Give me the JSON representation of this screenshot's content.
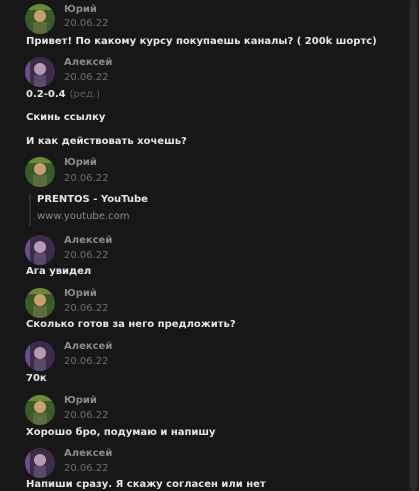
{
  "messages": [
    {
      "author": "Юрий",
      "date": "20.06.22",
      "text": "Привет! По какому курсу покупаешь каналы? ( 200k шортс)"
    },
    {
      "author": "Алексей",
      "date": "20.06.22",
      "text": "0.2-0.4",
      "edited": "(ред.)"
    },
    {
      "text": "Скинь ссылку"
    },
    {
      "text": "И как действовать хочешь?"
    },
    {
      "author": "Юрий",
      "date": "20.06.22"
    },
    {
      "author": "Алексей",
      "date": "20.06.22",
      "text": "Ага увидел"
    },
    {
      "author": "Юрий",
      "date": "20.06.22",
      "text": "Сколько готов за него предложить?"
    },
    {
      "author": "Алексей",
      "date": "20.06.22",
      "text": "70к"
    },
    {
      "author": "Юрий",
      "date": "20.06.22",
      "text": "Хорошо бро, подумаю и напишу"
    },
    {
      "author": "Алексей",
      "date": "20.06.22",
      "text": "Напиши сразу. Я скажу согласен или нет"
    }
  ],
  "link_preview": {
    "title": "PRENTOS - YouTube",
    "host": "www.youtube.com"
  },
  "colors": {
    "background": "#171717",
    "text": "#e6e6e6",
    "author": "#8b8b8b",
    "date": "#6f6f6f",
    "avatar_yuri": "#3a5a2a",
    "avatar_aleksey": "#3b2d4a"
  },
  "icons": {
    "avatar_yuri": "yuri-avatar-icon",
    "avatar_aleksey": "aleksey-avatar-icon"
  }
}
